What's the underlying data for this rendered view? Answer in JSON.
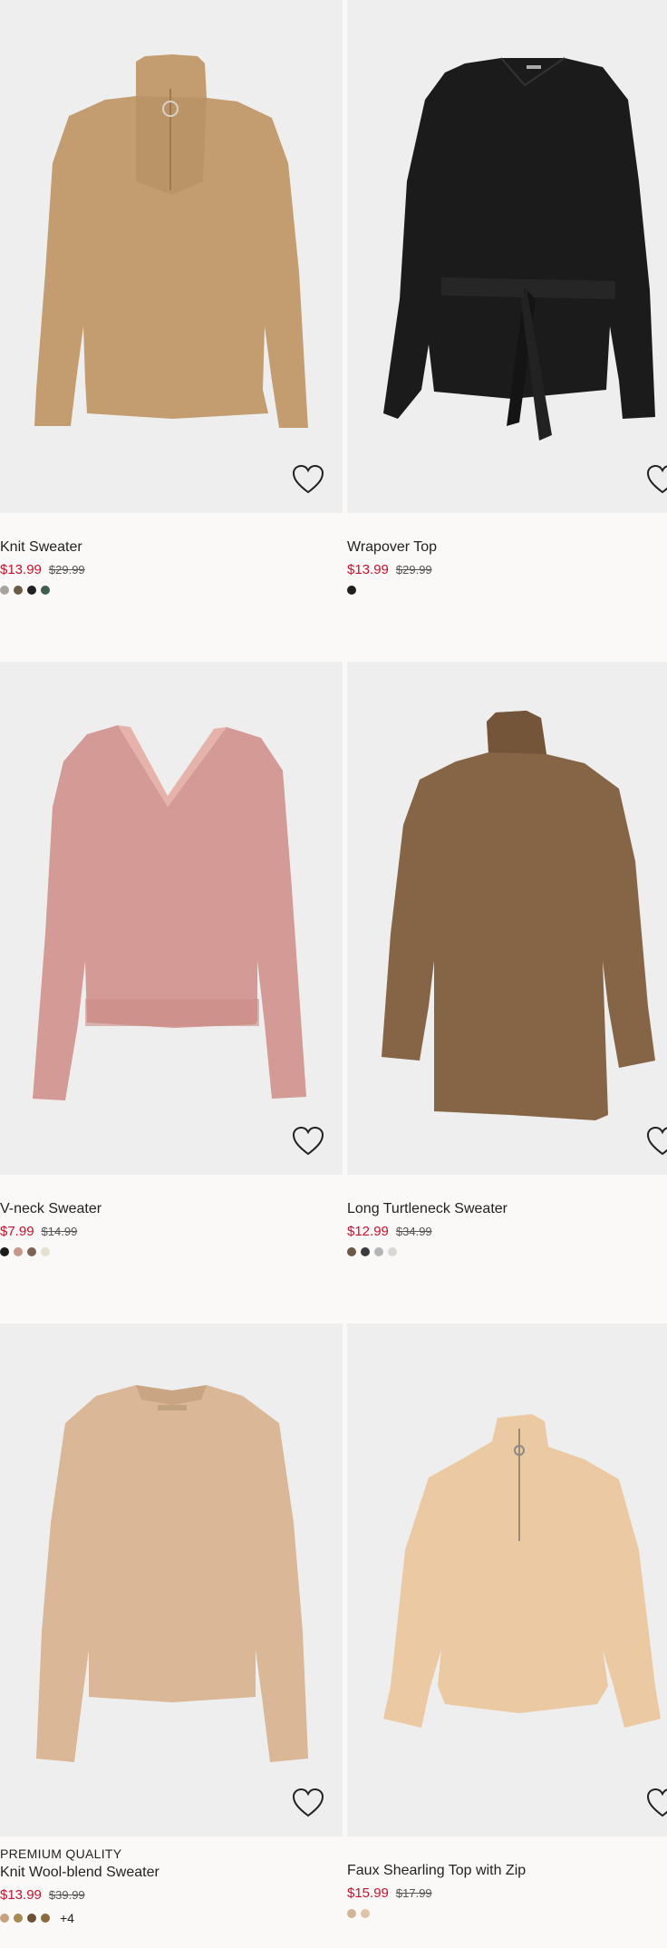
{
  "products": [
    {
      "kicker": "",
      "name": "Knit Sweater",
      "sale_price": "$13.99",
      "original_price": "$29.99",
      "colors": [
        "#a7a39f",
        "#6a5a48",
        "#222222",
        "#3f5e4e"
      ],
      "more_colors": "",
      "image_icon": "knit-sweater-image",
      "favorite_icon": "heart-icon"
    },
    {
      "kicker": "",
      "name": "Wrapover Top",
      "sale_price": "$13.99",
      "original_price": "$29.99",
      "colors": [
        "#1f1f1f"
      ],
      "more_colors": "",
      "image_icon": "wrapover-top-image",
      "favorite_icon": "heart-icon"
    },
    {
      "kicker": "",
      "name": "V-neck Sweater",
      "sale_price": "$7.99",
      "original_price": "$14.99",
      "colors": [
        "#1c1c1c",
        "#c9968c",
        "#7d6358",
        "#e4e0d2"
      ],
      "more_colors": "",
      "image_icon": "v-neck-sweater-image",
      "favorite_icon": "heart-icon"
    },
    {
      "kicker": "",
      "name": "Long Turtleneck Sweater",
      "sale_price": "$12.99",
      "original_price": "$34.99",
      "colors": [
        "#6d5948",
        "#3b3b3b",
        "#b3b4b8",
        "#d9d8d3"
      ],
      "more_colors": "",
      "image_icon": "long-turtleneck-sweater-image",
      "favorite_icon": "heart-icon"
    },
    {
      "kicker": "PREMIUM QUALITY",
      "name": "Knit Wool-blend Sweater",
      "sale_price": "$13.99",
      "original_price": "$39.99",
      "colors": [
        "#c8a27f",
        "#a8894f",
        "#6c5136",
        "#8a6a3e"
      ],
      "more_colors": "+4",
      "image_icon": "knit-wool-blend-sweater-image",
      "favorite_icon": "heart-icon"
    },
    {
      "kicker": "",
      "name": "Faux Shearling Top with Zip",
      "sale_price": "$15.99",
      "original_price": "$17.99",
      "colors": [
        "#d2b594",
        "#e0c2a8"
      ],
      "more_colors": "",
      "image_icon": "faux-shearling-top-image",
      "favorite_icon": "heart-icon"
    }
  ]
}
